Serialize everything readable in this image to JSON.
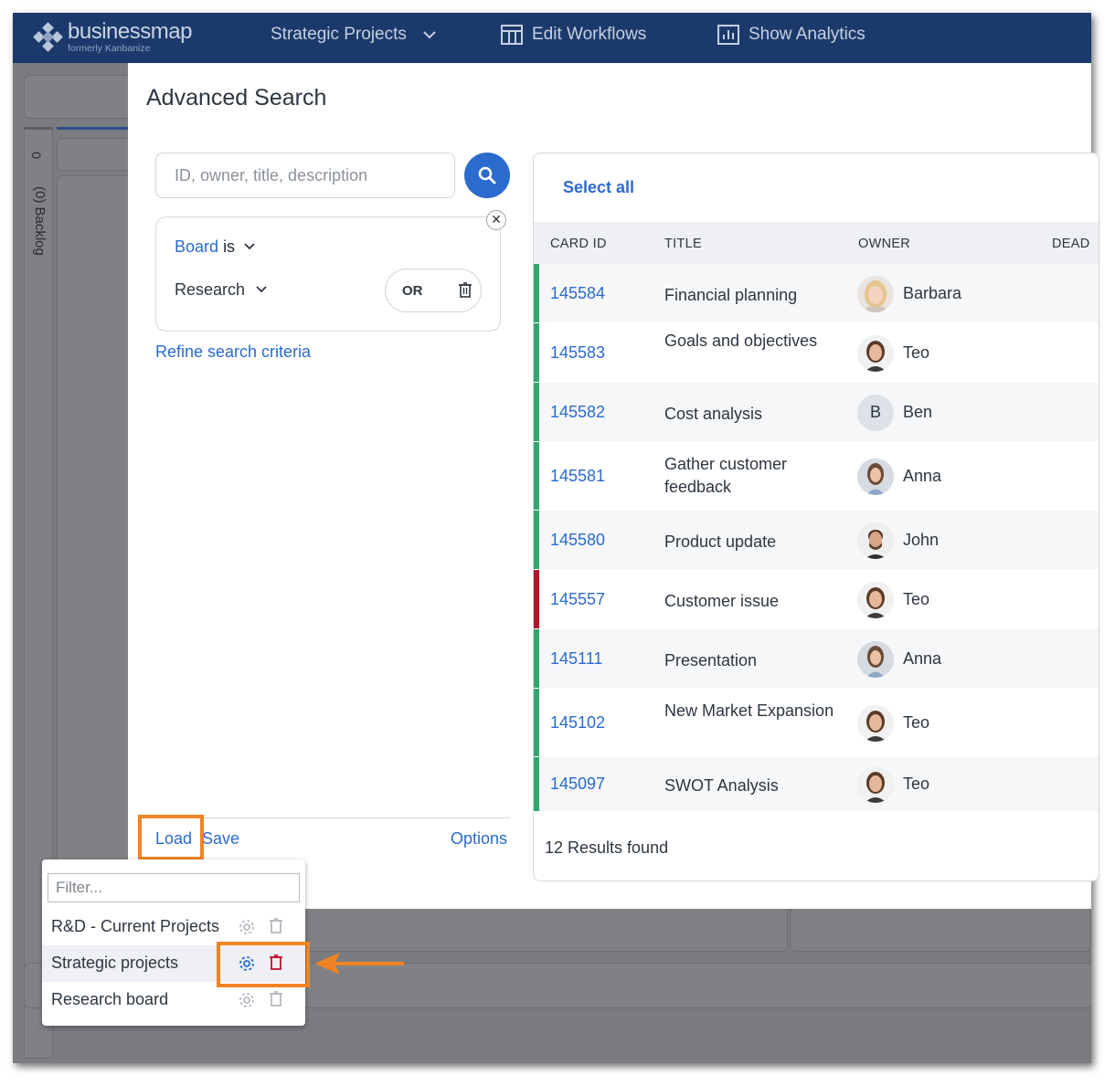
{
  "brand": {
    "name": "businessmap",
    "subtitle": "formerly Kanbanize"
  },
  "nav": [
    {
      "label": "Strategic Projects",
      "icon": "chevron-down-icon"
    },
    {
      "label": "Edit Workflows",
      "icon": "table-icon"
    },
    {
      "label": "Show Analytics",
      "icon": "analytics-icon"
    }
  ],
  "board": {
    "column_label": "(0) Backlog",
    "count": "0"
  },
  "modal": {
    "title": "Advanced Search",
    "search_placeholder": "ID, owner, title, description",
    "filter": {
      "field": "Board",
      "operator": "is",
      "value": "Research",
      "combinator": "OR"
    },
    "refine_label": "Refine search criteria",
    "footer": {
      "load": "Load",
      "save": "Save",
      "options": "Options"
    }
  },
  "results": {
    "select_all": "Select all",
    "columns": [
      "CARD ID",
      "TITLE",
      "OWNER",
      "DEAD"
    ],
    "rows": [
      {
        "id": "145584",
        "title": "Financial planning",
        "owner": "Barbara",
        "color": "#2fa86e",
        "avatar": "photo-woman-blonde"
      },
      {
        "id": "145583",
        "title": "Goals and objectives",
        "owner": "Teo",
        "color": "#2fa86e",
        "avatar": "photo-woman-dark"
      },
      {
        "id": "145582",
        "title": "Cost analysis",
        "owner": "Ben",
        "color": "#2fa86e",
        "avatar": "initial",
        "initial": "B"
      },
      {
        "id": "145581",
        "title": "Gather customer feedback",
        "owner": "Anna",
        "color": "#2fa86e",
        "avatar": "photo-woman-brown"
      },
      {
        "id": "145580",
        "title": "Product update",
        "owner": "John",
        "color": "#2fa86e",
        "avatar": "photo-man"
      },
      {
        "id": "145557",
        "title": "Customer issue",
        "owner": "Teo",
        "color": "#b3142a",
        "avatar": "photo-woman-dark"
      },
      {
        "id": "145111",
        "title": "Presentation",
        "owner": "Anna",
        "color": "#2fa86e",
        "avatar": "photo-woman-brown"
      },
      {
        "id": "145102",
        "title": "New Market Expansion",
        "owner": "Teo",
        "color": "#2fa86e",
        "avatar": "photo-woman-dark"
      },
      {
        "id": "145097",
        "title": "SWOT Analysis",
        "owner": "Teo",
        "color": "#2fa86e",
        "avatar": "photo-woman-dark"
      }
    ],
    "results_found": "12 Results found"
  },
  "load_menu": {
    "filter_placeholder": "Filter...",
    "items": [
      {
        "label": "R&D - Current Projects",
        "active": false
      },
      {
        "label": "Strategic projects",
        "active": true
      },
      {
        "label": "Research board",
        "active": false
      }
    ]
  },
  "colors": {
    "accent": "#2b6bcd",
    "topbar": "#1b3a6b",
    "highlight": "#f08423",
    "danger": "#c8102e"
  }
}
